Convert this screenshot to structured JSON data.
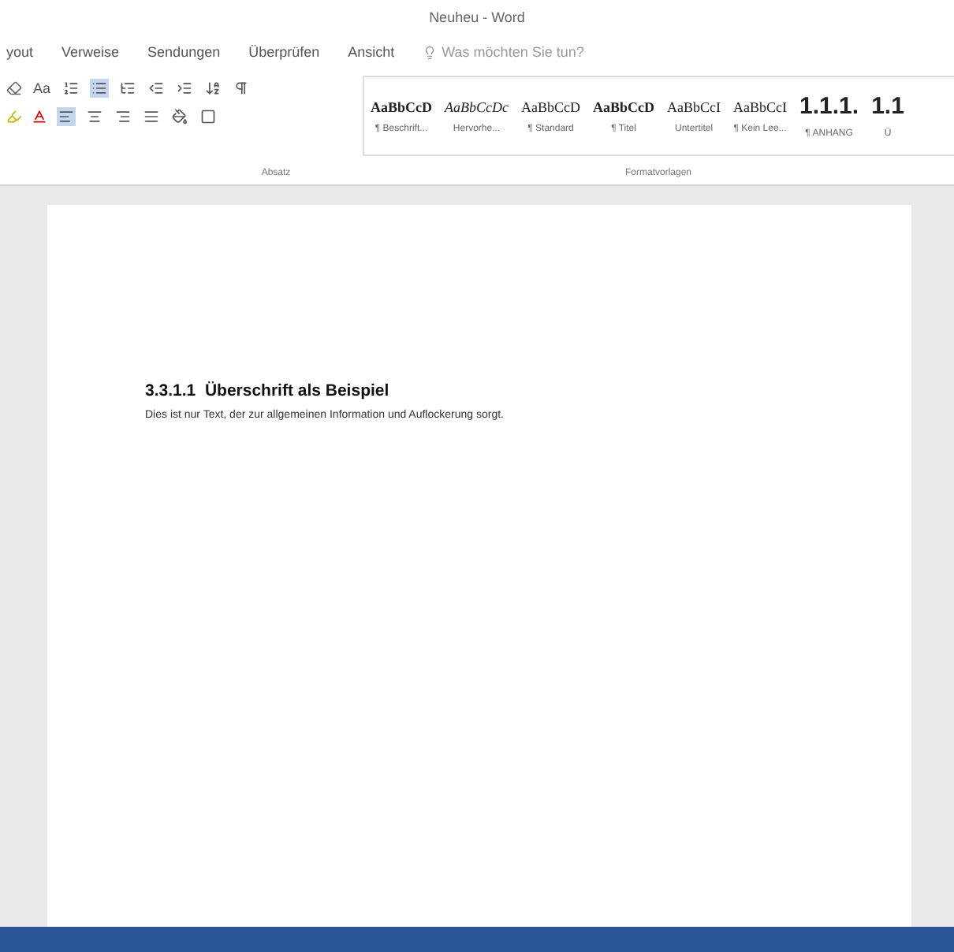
{
  "window": {
    "title": "Neuheu - Word"
  },
  "tabs": [
    {
      "label": "yout",
      "selected": false
    },
    {
      "label": "Verweise",
      "selected": false
    },
    {
      "label": "Sendungen",
      "selected": false
    },
    {
      "label": "Überprüfen",
      "selected": false
    },
    {
      "label": "Ansicht",
      "selected": false
    }
  ],
  "tell_me": {
    "placeholder": "Was möchten Sie tun?"
  },
  "ribbon": {
    "font_size_label": "Aa",
    "groups": [
      {
        "label": "Absatz"
      },
      {
        "label": "Formatvorlagen"
      }
    ],
    "styles": [
      {
        "preview": "AaBbCcD",
        "name": "¶ Beschrift...",
        "kind": "bold"
      },
      {
        "preview": "AaBbCcDc",
        "name": "Hervorhe...",
        "kind": "italic"
      },
      {
        "preview": "AaBbCcD",
        "name": "¶ Standard",
        "kind": "normal"
      },
      {
        "preview": "AaBbCcD",
        "name": "¶ Titel",
        "kind": "bold"
      },
      {
        "preview": "AaBbCcI",
        "name": "Untertitel",
        "kind": "normal"
      },
      {
        "preview": "AaBbCcI",
        "name": "¶ Kein Lee...",
        "kind": "normal"
      },
      {
        "preview": "1.1.1.",
        "name": "¶ ANHANG",
        "kind": "large"
      },
      {
        "preview": "1.1",
        "name": "Ü",
        "kind": "large"
      }
    ]
  },
  "document": {
    "heading": "3.3.1.1  Überschrift als Beispiel",
    "paragraph": "Dies ist nur Text, der zur allgemeinen Information und Auflockerung sorgt."
  }
}
